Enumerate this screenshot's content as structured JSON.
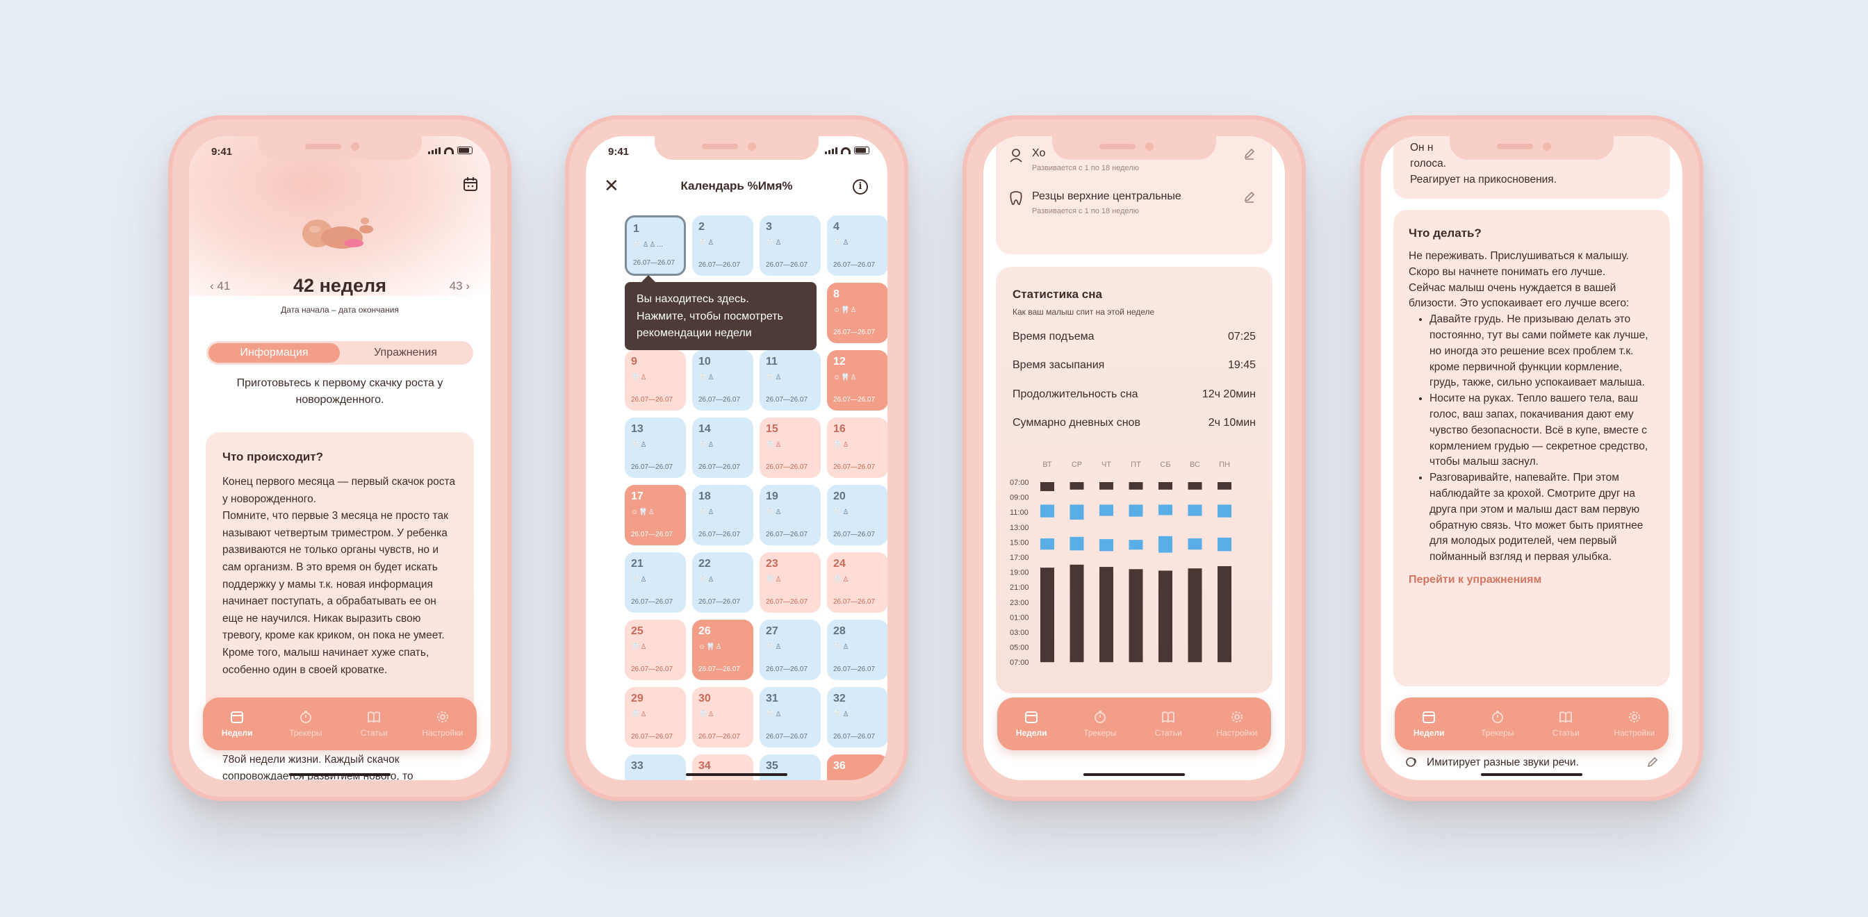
{
  "status_time": "9:41",
  "tabs": [
    "Недели",
    "Трекеры",
    "Статьи",
    "Настройки"
  ],
  "phone1": {
    "prev_week": "‹ 41",
    "next_week": "43 ›",
    "week_title": "42 неделя",
    "dates": "Дата начала – дата окончания",
    "seg_info": "Информация",
    "seg_ex": "Упражнения",
    "lead": "Приготовьтесь к первому скачку роста у новорожденного.",
    "card_title": "Что происходит?",
    "card_text": "Конец первого месяца — первый скачок роста у новорожденного.\nПомните, что первые 3 месяца не просто так называют четвертым триместром. У ребенка развиваются не только органы чувств, но и сам организм. В это время он будет искать поддержку у мамы т.к. новая информация начинает поступать, а обрабатывать ее он еще не научился. Никак выразить свою тревогу, кроме как криком, он пока не умеет. Кроме того, малыш начинает хуже спать, особенно один в своей кроватке.",
    "below_text": "78ой недели жизни. Каждый скачок сопровождается развитием нового, то"
  },
  "phone2": {
    "title": "Календарь %Имя%",
    "tooltip": "Вы находитесь здесь.\nНажмите, чтобы посмотреть рекомендации недели",
    "date_range": "26.07—26.07",
    "cells": [
      {
        "n": "1",
        "t": "cur",
        "ic": "🦷♙♙…"
      },
      {
        "n": "2",
        "t": "blue",
        "ic": "🦷♙"
      },
      {
        "n": "3",
        "t": "blue",
        "ic": "🦷♙"
      },
      {
        "n": "4",
        "t": "blue",
        "ic": "🦷♙"
      },
      {
        "n": "8",
        "t": "dark",
        "ic": "☺🦷♙"
      },
      {
        "n": "9",
        "t": "pink",
        "ic": "🦷♙"
      },
      {
        "n": "10",
        "t": "blue",
        "ic": "🦷♙"
      },
      {
        "n": "11",
        "t": "blue",
        "ic": "🦷♙"
      },
      {
        "n": "12",
        "t": "dark",
        "ic": "☺🦷♙"
      },
      {
        "n": "13",
        "t": "blue",
        "ic": "🦷♙"
      },
      {
        "n": "14",
        "t": "blue",
        "ic": "🦷♙"
      },
      {
        "n": "15",
        "t": "pink",
        "ic": "🦷♙"
      },
      {
        "n": "16",
        "t": "pink",
        "ic": "🦷♙"
      },
      {
        "n": "17",
        "t": "dark",
        "ic": "☺🦷♙"
      },
      {
        "n": "18",
        "t": "blue",
        "ic": "🦷♙"
      },
      {
        "n": "19",
        "t": "blue",
        "ic": "🦷♙"
      },
      {
        "n": "20",
        "t": "blue",
        "ic": "🦷♙"
      },
      {
        "n": "21",
        "t": "blue",
        "ic": "🦷♙"
      },
      {
        "n": "22",
        "t": "blue",
        "ic": "🦷♙"
      },
      {
        "n": "23",
        "t": "pink",
        "ic": "🦷♙"
      },
      {
        "n": "24",
        "t": "pink",
        "ic": "🦷♙"
      },
      {
        "n": "25",
        "t": "pink",
        "ic": "🦷♙"
      },
      {
        "n": "26",
        "t": "dark",
        "ic": "☺🦷♙"
      },
      {
        "n": "27",
        "t": "blue",
        "ic": "🦷♙"
      },
      {
        "n": "28",
        "t": "blue",
        "ic": "🦷♙"
      },
      {
        "n": "29",
        "t": "pink",
        "ic": "🦷♙"
      },
      {
        "n": "30",
        "t": "pink",
        "ic": "🦷♙"
      },
      {
        "n": "31",
        "t": "blue",
        "ic": "🦷♙"
      },
      {
        "n": "32",
        "t": "blue",
        "ic": "🦷♙"
      },
      {
        "n": "33",
        "t": "blue",
        "ic": ""
      },
      {
        "n": "34",
        "t": "pink",
        "ic": ""
      },
      {
        "n": "35",
        "t": "blue",
        "ic": ""
      },
      {
        "n": "36",
        "t": "dark",
        "ic": ""
      }
    ]
  },
  "phone3": {
    "item1_label": "Хо",
    "item1_sub": "Развивается с 1 по 18 неделю",
    "item2_label": "Резцы верхние центральные",
    "item2_sub": "Развивается с 1 по 18 неделю",
    "sleep_title": "Статистика сна",
    "sleep_sub": "Как ваш малыш спит на этой неделе",
    "rows": [
      {
        "label": "Время подъема",
        "value": "07:25"
      },
      {
        "label": "Время засыпания",
        "value": "19:45"
      },
      {
        "label": "Продолжительность сна",
        "value": "12ч 20мин"
      },
      {
        "label": "Суммарно дневных снов",
        "value": "2ч 10мин"
      }
    ]
  },
  "chart_data": {
    "type": "bar",
    "categories": [
      "ВТ",
      "СР",
      "ЧТ",
      "ПТ",
      "СБ",
      "ВС",
      "ПН"
    ],
    "y_ticks": [
      "07:00",
      "09:00",
      "11:00",
      "13:00",
      "15:00",
      "17:00",
      "19:00",
      "21:00",
      "23:00",
      "01:00",
      "03:00",
      "05:00",
      "07:00"
    ],
    "night_sleep": [
      [
        0,
        1.2
      ],
      [
        0,
        1.0
      ],
      [
        0,
        1.0
      ],
      [
        0,
        1.0
      ],
      [
        0,
        1.0
      ],
      [
        0,
        1.0
      ],
      [
        0,
        1.0
      ]
    ],
    "day_naps": [
      [
        3,
        4.7
      ],
      [
        3,
        5.0
      ],
      [
        3,
        4.5
      ],
      [
        3,
        4.6
      ],
      [
        3,
        4.4
      ],
      [
        3,
        4.5
      ],
      [
        3,
        4.7
      ]
    ],
    "day_naps2": [
      [
        7.5,
        9.0
      ],
      [
        7.3,
        9.1
      ],
      [
        7.6,
        9.2
      ],
      [
        7.7,
        9.0
      ],
      [
        7.2,
        9.4
      ],
      [
        7.5,
        9.0
      ],
      [
        7.4,
        9.2
      ]
    ],
    "evening_sleep": [
      [
        11.4,
        24
      ],
      [
        11.0,
        24
      ],
      [
        11.3,
        24
      ],
      [
        11.6,
        24
      ],
      [
        11.8,
        24
      ],
      [
        11.5,
        24
      ],
      [
        11.2,
        24
      ]
    ],
    "colors": {
      "dark": "#4a3733",
      "blue": "#5aaee6"
    }
  },
  "phone4": {
    "top_partial": "Он н",
    "top_partial2": "голоса.",
    "top_line": "Реагирует на прикосновения.",
    "title": "Что делать?",
    "intro": "Не переживать. Прислушиваться к малышу. Скоро вы начнете понимать его лучше.\nСейчас малыш очень нуждается в вашей близости. Это успокаивает его лучше всего:",
    "bullets": [
      "Давайте грудь. Не призываю делать это постоянно, тут вы сами поймете как лучше, но иногда это решение всех проблем т.к. кроме первичной функции кормление, грудь, также, сильно успокаивает малыша.",
      "Носите на руках. Тепло вашего тела, ваш голос, ваш запах, покачивания дают ему чувство безопасности. Всё в купе, вместе с кормлением грудью — секретное средство, чтобы малыш заснул.",
      "Разговаривайте, напевайте. При этом наблюдайте за крохой. Смотрите друг на друга при этом и малыш даст вам первую обратную связь. Что может быть приятнее для молодых родителей, чем первый пойманный взгляд и первая улыбка."
    ],
    "link": "Перейти к упражнениям",
    "bottom_item": "Имитирует разные звуки речи."
  }
}
